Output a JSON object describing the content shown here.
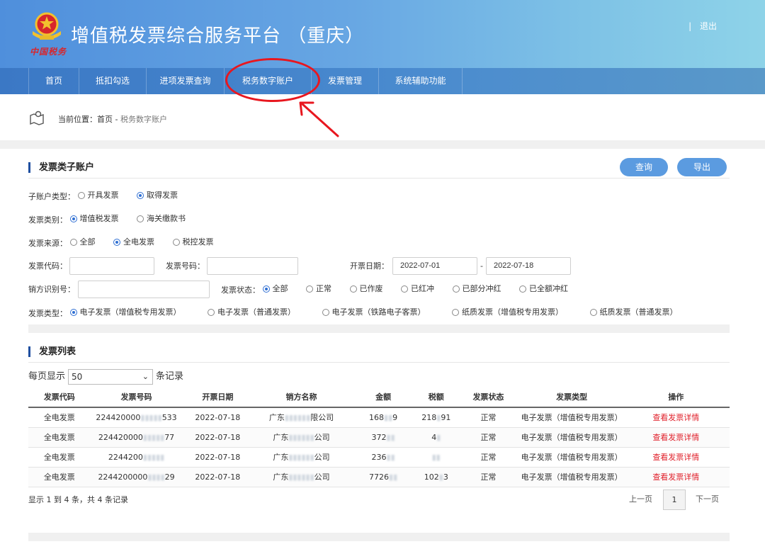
{
  "header": {
    "emblem_text": "中国税务",
    "title": "增值税发票综合服务平台 （重庆）",
    "separator": "|",
    "logout": "退出"
  },
  "nav": {
    "items": [
      {
        "label": "首页"
      },
      {
        "label": "抵扣勾选"
      },
      {
        "label": "进项发票查询"
      },
      {
        "label": "税务数字账户"
      },
      {
        "label": "发票管理"
      },
      {
        "label": "系统辅助功能"
      }
    ],
    "highlighted": "税务数字账户"
  },
  "breadcrumb": {
    "prefix": "当前位置：",
    "home": "首页",
    "sep": " - ",
    "current": "税务数字账户"
  },
  "filter": {
    "section_title": "发票类子账户",
    "query_button": "查询",
    "export_button": "导出",
    "account_type": {
      "label": "子账户类型：",
      "options": [
        "开具发票",
        "取得发票"
      ],
      "selected": "取得发票"
    },
    "invoice_category": {
      "label": "发票类别：",
      "options": [
        "增值税发票",
        "海关缴款书"
      ],
      "selected": "增值税发票"
    },
    "invoice_source": {
      "label": "发票来源：",
      "options": [
        "全部",
        "全电发票",
        "税控发票"
      ],
      "selected": "全电发票"
    },
    "invoice_code": {
      "label": "发票代码：",
      "value": ""
    },
    "invoice_number": {
      "label": "发票号码：",
      "value": ""
    },
    "issue_date": {
      "label": "开票日期：",
      "from": "2022-07-01",
      "dash": "-",
      "to": "2022-07-18"
    },
    "seller_id": {
      "label": "销方识别号：",
      "value": ""
    },
    "invoice_status": {
      "label": "发票状态：",
      "options": [
        "全部",
        "正常",
        "已作废",
        "已红冲",
        "已部分冲红",
        "已全额冲红"
      ],
      "selected": "全部"
    },
    "invoice_type": {
      "label": "发票类型：",
      "options": [
        "电子发票（增值税专用发票）",
        "电子发票（普通发票）",
        "电子发票（铁路电子客票）",
        "纸质发票（增值税专用发票）",
        "纸质发票（普通发票）"
      ],
      "selected": "电子发票（增值税专用发票）"
    }
  },
  "list": {
    "section_title": "发票列表",
    "page_size_prefix": "每页显示",
    "page_size": "50",
    "page_size_suffix": "条记录",
    "columns": [
      "发票代码",
      "发票号码",
      "开票日期",
      "销方名称",
      "金额",
      "税额",
      "发票状态",
      "发票类型",
      "操作"
    ],
    "rows": [
      {
        "code": "全电发票",
        "no_a": "224420000",
        "no_b": "533",
        "date": "2022-07-18",
        "seller_a": "广东",
        "seller_b": "限公司",
        "amount_a": "168",
        "amount_b": "9",
        "tax_a": "218",
        "tax_b": "91",
        "status": "正常",
        "type": "电子发票（增值税专用发票）",
        "action": "查看发票详情"
      },
      {
        "code": "全电发票",
        "no_a": "224420000",
        "no_b": "77",
        "date": "2022-07-18",
        "seller_a": "广东",
        "seller_b": "公司",
        "amount_a": "372",
        "amount_b": "",
        "tax_a": "4",
        "tax_b": "",
        "status": "正常",
        "type": "电子发票（增值税专用发票）",
        "action": "查看发票详情"
      },
      {
        "code": "全电发票",
        "no_a": "2244200",
        "no_b": "",
        "date": "2022-07-18",
        "seller_a": "广东",
        "seller_b": "公司",
        "amount_a": "236",
        "amount_b": "",
        "tax_a": "",
        "tax_b": "",
        "status": "正常",
        "type": "电子发票（增值税专用发票）",
        "action": "查看发票详情"
      },
      {
        "code": "全电发票",
        "no_a": "2244200000",
        "no_b": "29",
        "date": "2022-07-18",
        "seller_a": "广东",
        "seller_b": "公司",
        "amount_a": "7726",
        "amount_b": "",
        "tax_a": "102",
        "tax_b": "3",
        "status": "正常",
        "type": "电子发票（增值税专用发票）",
        "action": "查看发票详情"
      }
    ],
    "summary": "显示 1 到 4 条，共 4 条记录",
    "prev": "上一页",
    "current_page": "1",
    "next": "下一页"
  }
}
